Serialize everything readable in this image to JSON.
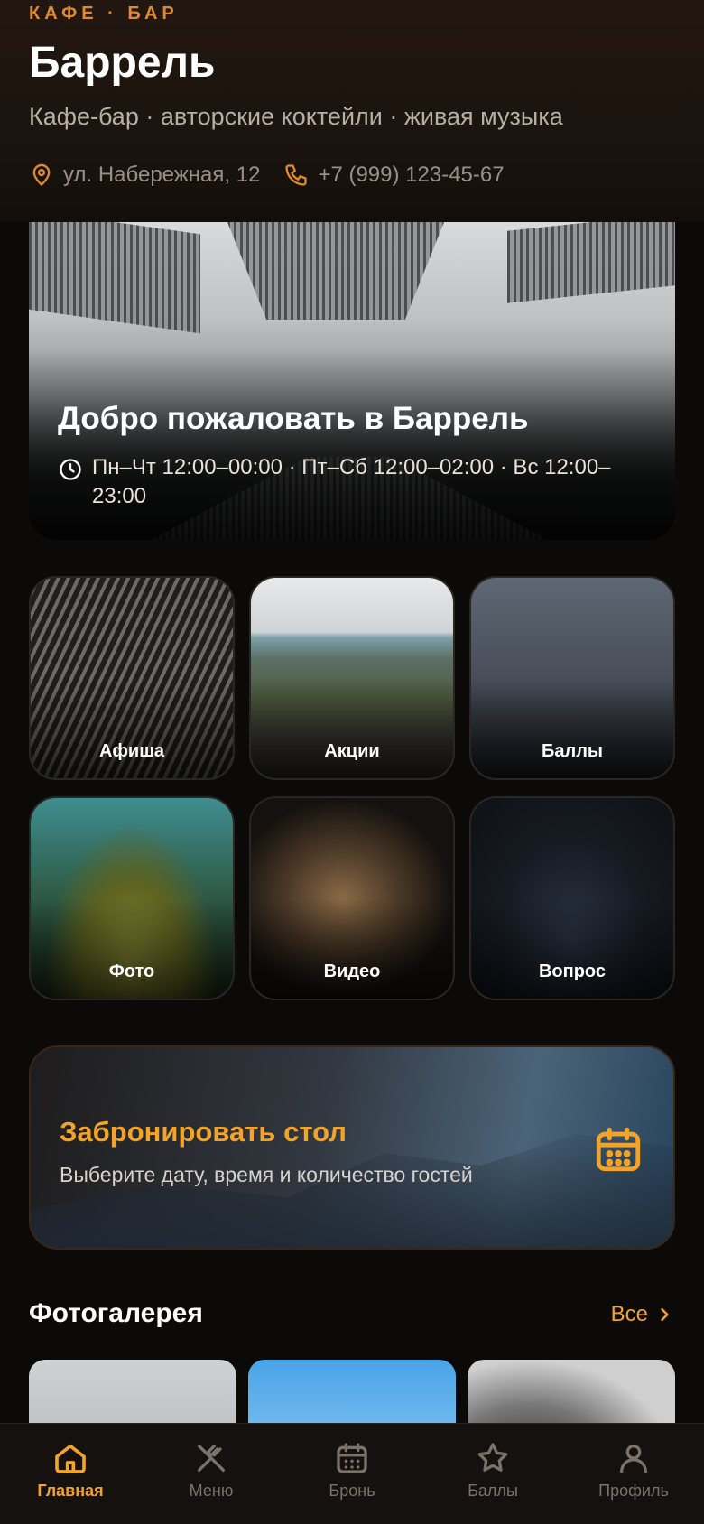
{
  "header": {
    "kicker": "КАФЕ · БАР",
    "brand": "Баррель",
    "tagline": "Кафе-бар · авторские коктейли · живая музыка",
    "address": "ул. Набережная, 12",
    "phone": "+7 (999) 123-45-67"
  },
  "hero": {
    "title": "Добро пожаловать в Баррель",
    "hours": "Пн–Чт 12:00–00:00 · Пт–Сб 12:00–02:00 · Вс 12:00–23:00"
  },
  "tiles": [
    {
      "label": "Афиша"
    },
    {
      "label": "Акции"
    },
    {
      "label": "Баллы"
    },
    {
      "label": "Фото"
    },
    {
      "label": "Видео"
    },
    {
      "label": "Вопрос"
    }
  ],
  "booking": {
    "title": "Забронировать стол",
    "subtitle": "Выберите дату, время и количество гостей"
  },
  "gallery": {
    "title": "Фотогалерея",
    "all_label": "Все"
  },
  "nav": {
    "items": [
      {
        "label": "Главная",
        "icon": "home-icon"
      },
      {
        "label": "Меню",
        "icon": "utensils-icon"
      },
      {
        "label": "Бронь",
        "icon": "calendar-icon"
      },
      {
        "label": "Баллы",
        "icon": "star-icon"
      },
      {
        "label": "Профиль",
        "icon": "user-icon"
      }
    ],
    "active_index": 0
  },
  "colors": {
    "accent": "#f2a32a",
    "background": "#0c0a09"
  }
}
